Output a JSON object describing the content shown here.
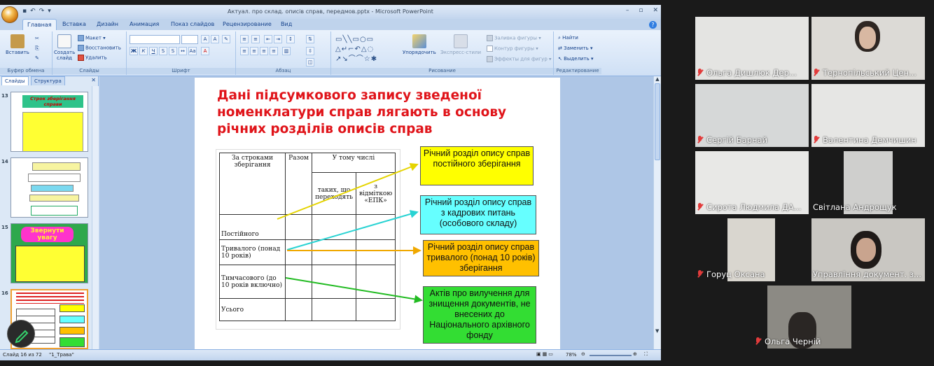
{
  "ppt": {
    "window_title": "Актуал. про склад. описів справ, передмов.pptx - Microsoft PowerPoint",
    "tabs": [
      "Главная",
      "Вставка",
      "Дизайн",
      "Анимация",
      "Показ слайдов",
      "Рецензирование",
      "Вид"
    ],
    "ribbon": {
      "clipboard": {
        "paste": "Вставить",
        "label": "Буфер обмена"
      },
      "slides": {
        "create": "Создать слайд",
        "layout": "Макет",
        "reset": "Восстановить",
        "delete": "Удалить",
        "label": "Слайды"
      },
      "font": {
        "label": "Шрифт"
      },
      "paragraph": {
        "label": "Абзац"
      },
      "drawing": {
        "arrange": "Упорядочить",
        "styles": "Экспресс-стили",
        "fill": "Заливка фигуры",
        "outline": "Контур фигуры",
        "effects": "Эффекты для фигур",
        "label": "Рисование"
      },
      "editing": {
        "find": "Найти",
        "replace": "Заменить",
        "select": "Выделить",
        "label": "Редактирование"
      }
    },
    "panel_tabs": [
      "Слайды",
      "Структура"
    ],
    "thumbnails": [
      {
        "num": "13",
        "title": "Строк зберігання справи"
      },
      {
        "num": "14"
      },
      {
        "num": "15",
        "title": "Звернути увагу"
      },
      {
        "num": "16"
      }
    ],
    "slide": {
      "title": "Дані підсумкового запису зведеної номенклатури справ лягають в основу річних розділів описів справ",
      "table": {
        "h_retention": "За строками зберігання",
        "h_total": "Разом",
        "h_including": "У тому числі",
        "h_transferred": "таких, що переходять",
        "h_epk": "з відміткою «ЕПК»",
        "rows": [
          "Постійного",
          "Тривалого (понад 10 років)",
          "Тимчасового (до 10 років включно)",
          "Усього"
        ]
      },
      "boxes": [
        {
          "text": "Річний розділ опису справ постійного зберігання",
          "bg": "#ffff00"
        },
        {
          "text": "Річний розділ опису справ з кадрових питань (особового складу)",
          "bg": "#66ffff"
        },
        {
          "text": "Річний розділ опису справ тривалого (понад 10 років) зберігання",
          "bg": "#ffc000"
        },
        {
          "text": "Актів про вилучення для знищення документів, не внесених до Національного архівного фонду",
          "bg": "#33dd33"
        }
      ]
    },
    "status": {
      "slide": "Слайд 16 из 72",
      "theme": "\"1_Трава\"",
      "zoom": "78%"
    }
  },
  "participants": [
    {
      "name": "Ольга Дишлюк Дер..."
    },
    {
      "name": "Тернопільський Цен..."
    },
    {
      "name": "Сергій Барнай"
    },
    {
      "name": "Валентина Демчишин"
    },
    {
      "name": "Сирота Людмила ДА..."
    },
    {
      "name": "Світлана Андрощук"
    },
    {
      "name": "Горуц Оксана"
    },
    {
      "name": "Управління документ. з..."
    },
    {
      "name": "Ольга Черній"
    }
  ]
}
